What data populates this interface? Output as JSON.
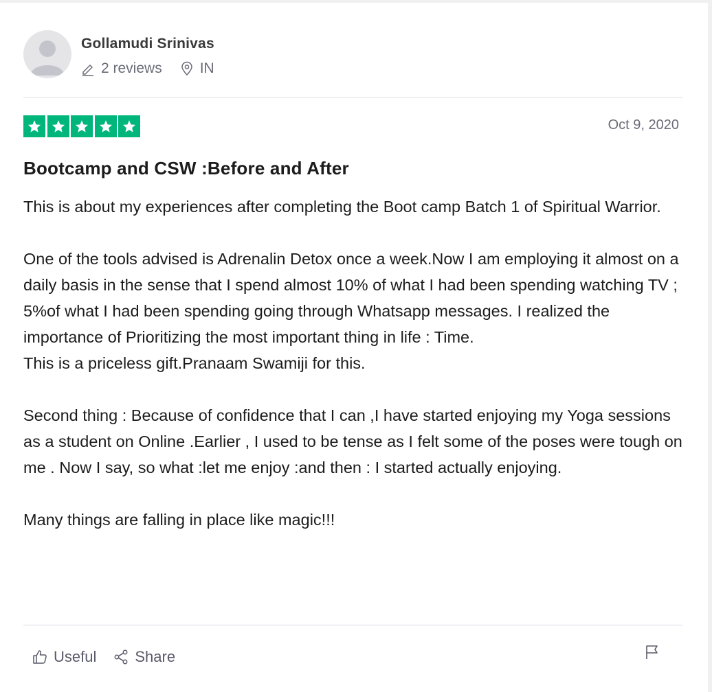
{
  "reviewer": {
    "name": "Gollamudi Srinivas",
    "reviews": "2 reviews",
    "country": "IN"
  },
  "review": {
    "rating": 5,
    "date": "Oct 9, 2020",
    "title": "Bootcamp and CSW :Before and After",
    "paragraphs": [
      "This is about my experiences after completing the Boot camp Batch 1 of Spiritual Warrior.",
      "",
      "One of the tools advised is Adrenalin Detox once a week.Now I am employing it almost on a daily basis in the sense that I spend almost 10% of what I had been spending watching TV ; 5%of what I had been spending going through Whatsapp messages. I realized the importance of Prioritizing the most important thing in life : Time.",
      "This is a priceless gift.Pranaam Swamiji for this.",
      "",
      "Second thing : Because of confidence that I can ,I have started enjoying my Yoga sessions as a student on Online .Earlier , I used to be tense as I felt some of the poses were tough on me . Now I say, so what :let me enjoy :and then : I started actually enjoying.",
      "",
      "Many things are falling in place like magic!!!"
    ]
  },
  "actions": {
    "useful_label": "Useful",
    "share_label": "Share"
  },
  "icons": [
    "avatar-placeholder",
    "pencil-icon",
    "location-pin-icon",
    "star-icon",
    "thumbs-up-icon",
    "share-icon",
    "flag-icon"
  ],
  "colors": {
    "star_green": "#00b67a",
    "muted_text": "#6b6b78",
    "divider": "#dcdce6"
  }
}
